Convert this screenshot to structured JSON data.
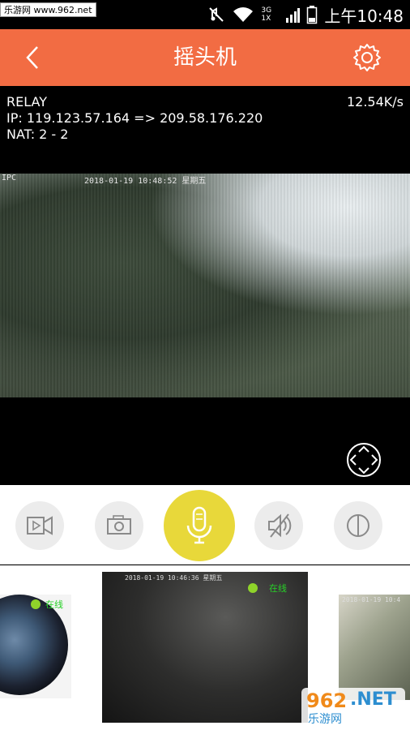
{
  "status_bar": {
    "watermark": "乐游网 www.962.net",
    "network": "3G 1X",
    "time": "上午10:48",
    "icons": [
      "image-icon",
      "mute-icon",
      "wifi-icon",
      "signal-icon",
      "battery-icon"
    ]
  },
  "app_bar": {
    "title": "摇头机",
    "back_icon": "chevron-left-icon",
    "settings_icon": "gear-icon",
    "color": "#f26c43"
  },
  "connection": {
    "mode": "RELAY",
    "ip": "IP: 119.123.57.164 => 209.58.176.220",
    "nat": "NAT: 2 - 2",
    "speed": "12.54K/s"
  },
  "video": {
    "osd_label": "IPC",
    "osd_time": "2018-01-19 10:48:52 星期五",
    "ptz_icon": "pan-tilt-arrows-icon"
  },
  "controls": [
    {
      "name": "record-button",
      "icon": "video-camera-icon"
    },
    {
      "name": "snapshot-button",
      "icon": "camera-icon"
    },
    {
      "name": "talk-button",
      "icon": "microphone-icon",
      "color": "#e8d83a"
    },
    {
      "name": "mute-button",
      "icon": "speaker-muted-icon"
    },
    {
      "name": "display-mode-button",
      "icon": "half-circle-icon"
    }
  ],
  "thumbnails": {
    "online_label": "在线",
    "center_time": "2018-01-19 10:46:36 星期五",
    "right_time": "2018-01-19 10:4"
  },
  "footer_watermark": {
    "number": "962",
    "suffix": ".NET",
    "text": "乐游网"
  }
}
